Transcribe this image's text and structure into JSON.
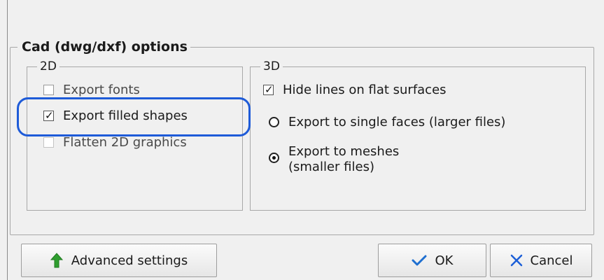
{
  "cad_options": {
    "title": "Cad (dwg/dxf) options",
    "group_2d": {
      "label": "2D",
      "options": [
        {
          "label": "Export fonts",
          "checked": false
        },
        {
          "label": "Export filled shapes",
          "checked": true
        },
        {
          "label": "Flatten 2D graphics",
          "checked": false
        }
      ]
    },
    "group_3d": {
      "label": "3D",
      "hide_lines": {
        "label": "Hide lines on flat surfaces",
        "checked": true
      },
      "export_mode": {
        "options": [
          {
            "label_line1": "Export to single faces (larger files)",
            "label_line2": "",
            "selected": false
          },
          {
            "label_line1": "Export to meshes",
            "label_line2": "(smaller files)",
            "selected": true
          }
        ]
      }
    }
  },
  "buttons": {
    "advanced": "Advanced settings",
    "ok": "OK",
    "cancel": "Cancel"
  },
  "colors": {
    "highlight": "#1e5bd8",
    "arrow_green": "#2f9e2f",
    "ok_check": "#1e6fd0",
    "cancel_x": "#1c5fd8"
  },
  "icons": {
    "advanced": "green-up-arrow-icon",
    "ok": "checkmark-icon",
    "cancel": "x-icon"
  }
}
